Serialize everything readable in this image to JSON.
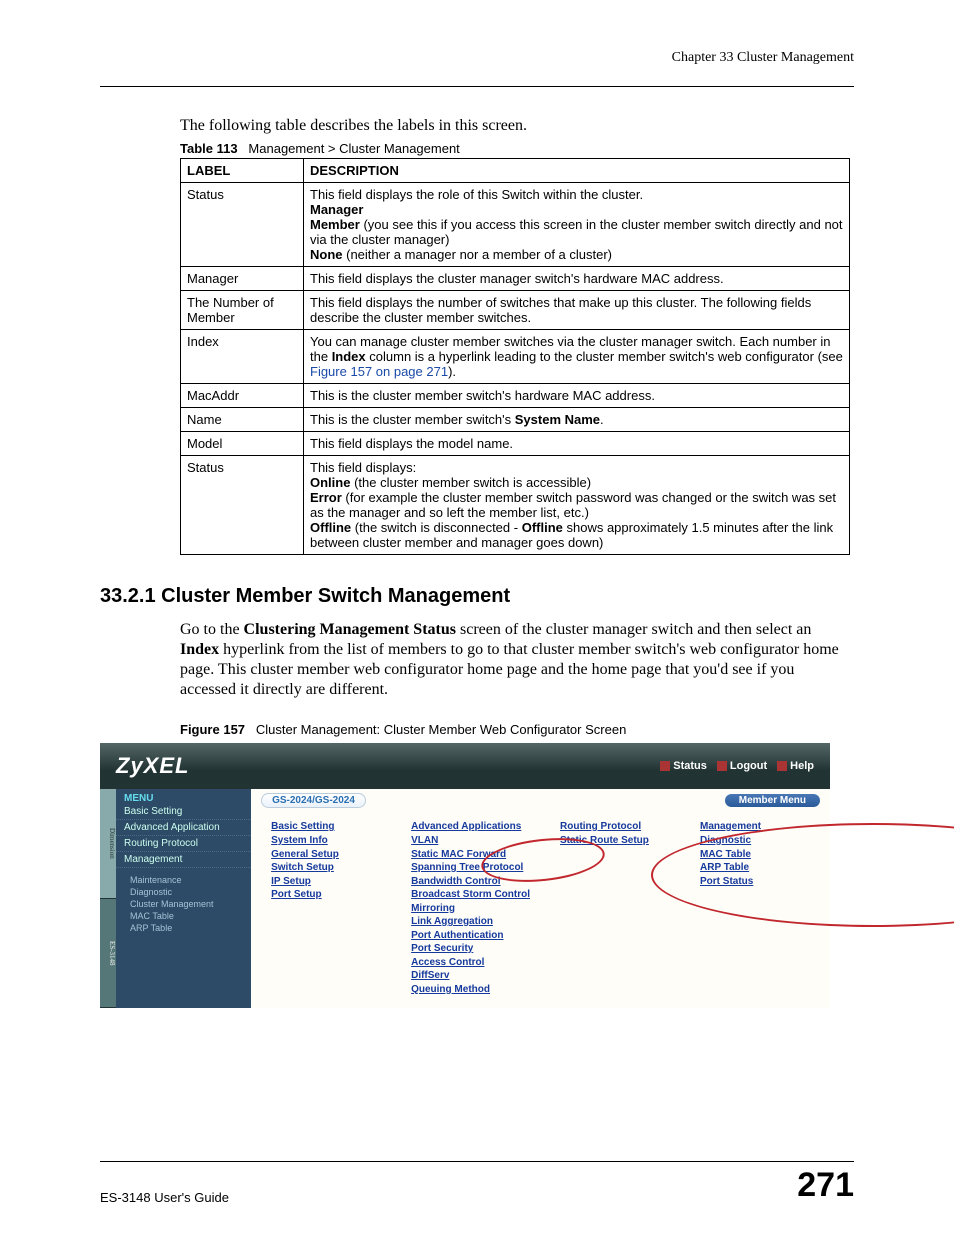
{
  "header": {
    "chapter": "Chapter 33 Cluster Management"
  },
  "intro": "The following table describes the labels in this screen.",
  "table_caption": {
    "num": "Table 113",
    "title": "Management > Cluster Management"
  },
  "table": {
    "headers": [
      "LABEL",
      "DESCRIPTION"
    ],
    "rows": [
      {
        "label": "Status",
        "desc_parts": {
          "line1": "This field displays the role of this Switch within the cluster.",
          "b_manager": "Manager",
          "b_member": "Member",
          "member_rest": " (you see this if you access this screen in the cluster member switch directly and not via the cluster manager)",
          "b_none": "None",
          "none_rest": " (neither a manager nor a member of a cluster)"
        }
      },
      {
        "label": "Manager",
        "desc_plain": "This field displays the cluster manager switch's hardware MAC address."
      },
      {
        "label": "The Number of Member",
        "desc_plain": "This field displays the number of switches that make up this cluster. The following fields describe the cluster member switches."
      },
      {
        "label": "Index",
        "desc_parts": {
          "pre": "You can manage cluster member switches via the cluster manager switch. Each number in the ",
          "b_index": "Index",
          "mid": " column is a hyperlink leading to the cluster member switch's web configurator (see ",
          "link": "Figure 157 on page 271",
          "post": ")."
        }
      },
      {
        "label": "MacAddr",
        "desc_plain": "This is the cluster member switch's hardware MAC address."
      },
      {
        "label": "Name",
        "desc_parts": {
          "pre": "This is the cluster member switch's ",
          "b_sys": "System Name",
          "post": "."
        }
      },
      {
        "label": "Model",
        "desc_plain": "This field displays the model name."
      },
      {
        "label": "Status",
        "desc_parts": {
          "line1": "This field displays:",
          "b_online": "Online",
          "online_rest": " (the cluster member switch is accessible)",
          "b_error": "Error",
          "error_rest": " (for example the cluster member switch password was changed or the switch was set as the manager and so left the member list, etc.)",
          "b_offline1": "Offline",
          "offline_mid": " (the switch is disconnected - ",
          "b_offline2": "Offline",
          "offline_rest": " shows approximately 1.5 minutes after the link between cluster member and manager goes down)"
        }
      }
    ]
  },
  "section": {
    "num_title": "33.2.1  Cluster Member Switch Management",
    "p_parts": {
      "pre": "Go to the ",
      "b1": "Clustering Management Status",
      "mid1": " screen of the cluster manager switch and then select an ",
      "b2": "Index",
      "post": " hyperlink from the list of members to go to that cluster member switch's web configurator home page. This cluster member web configurator home page and the home page that you'd see if you accessed it directly are different."
    }
  },
  "figure": {
    "caption_num": "Figure 157",
    "caption_title": "Cluster Management: Cluster Member Web Configurator Screen",
    "brand": "ZyXEL",
    "top_links": [
      "Status",
      "Logout",
      "Help"
    ],
    "vert_tabs": [
      "Dimension",
      "ES-3148"
    ],
    "sidebar": {
      "menu": "MENU",
      "items": [
        "Basic Setting",
        "Advanced Application",
        "Routing Protocol",
        "Management"
      ],
      "subs": [
        "Maintenance",
        "Diagnostic",
        "Cluster Management",
        "MAC Table",
        "ARP Table"
      ]
    },
    "breadcrumb_left": "GS-2024/GS-2024",
    "breadcrumb_right": "Member Menu",
    "cols": [
      {
        "head": "Basic Setting",
        "links": [
          "System Info",
          "General Setup",
          "Switch Setup",
          "IP Setup",
          "Port Setup"
        ]
      },
      {
        "head": "Advanced Applications",
        "links": [
          "VLAN",
          "Static MAC Forward",
          "Spanning Tree Protocol",
          "Bandwidth Control",
          "Broadcast Storm Control",
          "Mirroring",
          "Link Aggregation",
          "Port Authentication",
          "Port Security",
          "Access Control",
          "DiffServ",
          "Queuing Method"
        ]
      },
      {
        "head": "Routing Protocol",
        "links": [
          "Static Route Setup"
        ]
      },
      {
        "head": "Management",
        "links": [
          "Diagnostic",
          "MAC Table",
          "ARP Table",
          "Port Status"
        ]
      }
    ]
  },
  "footer": {
    "left": "ES-3148 User's Guide",
    "right": "271"
  }
}
